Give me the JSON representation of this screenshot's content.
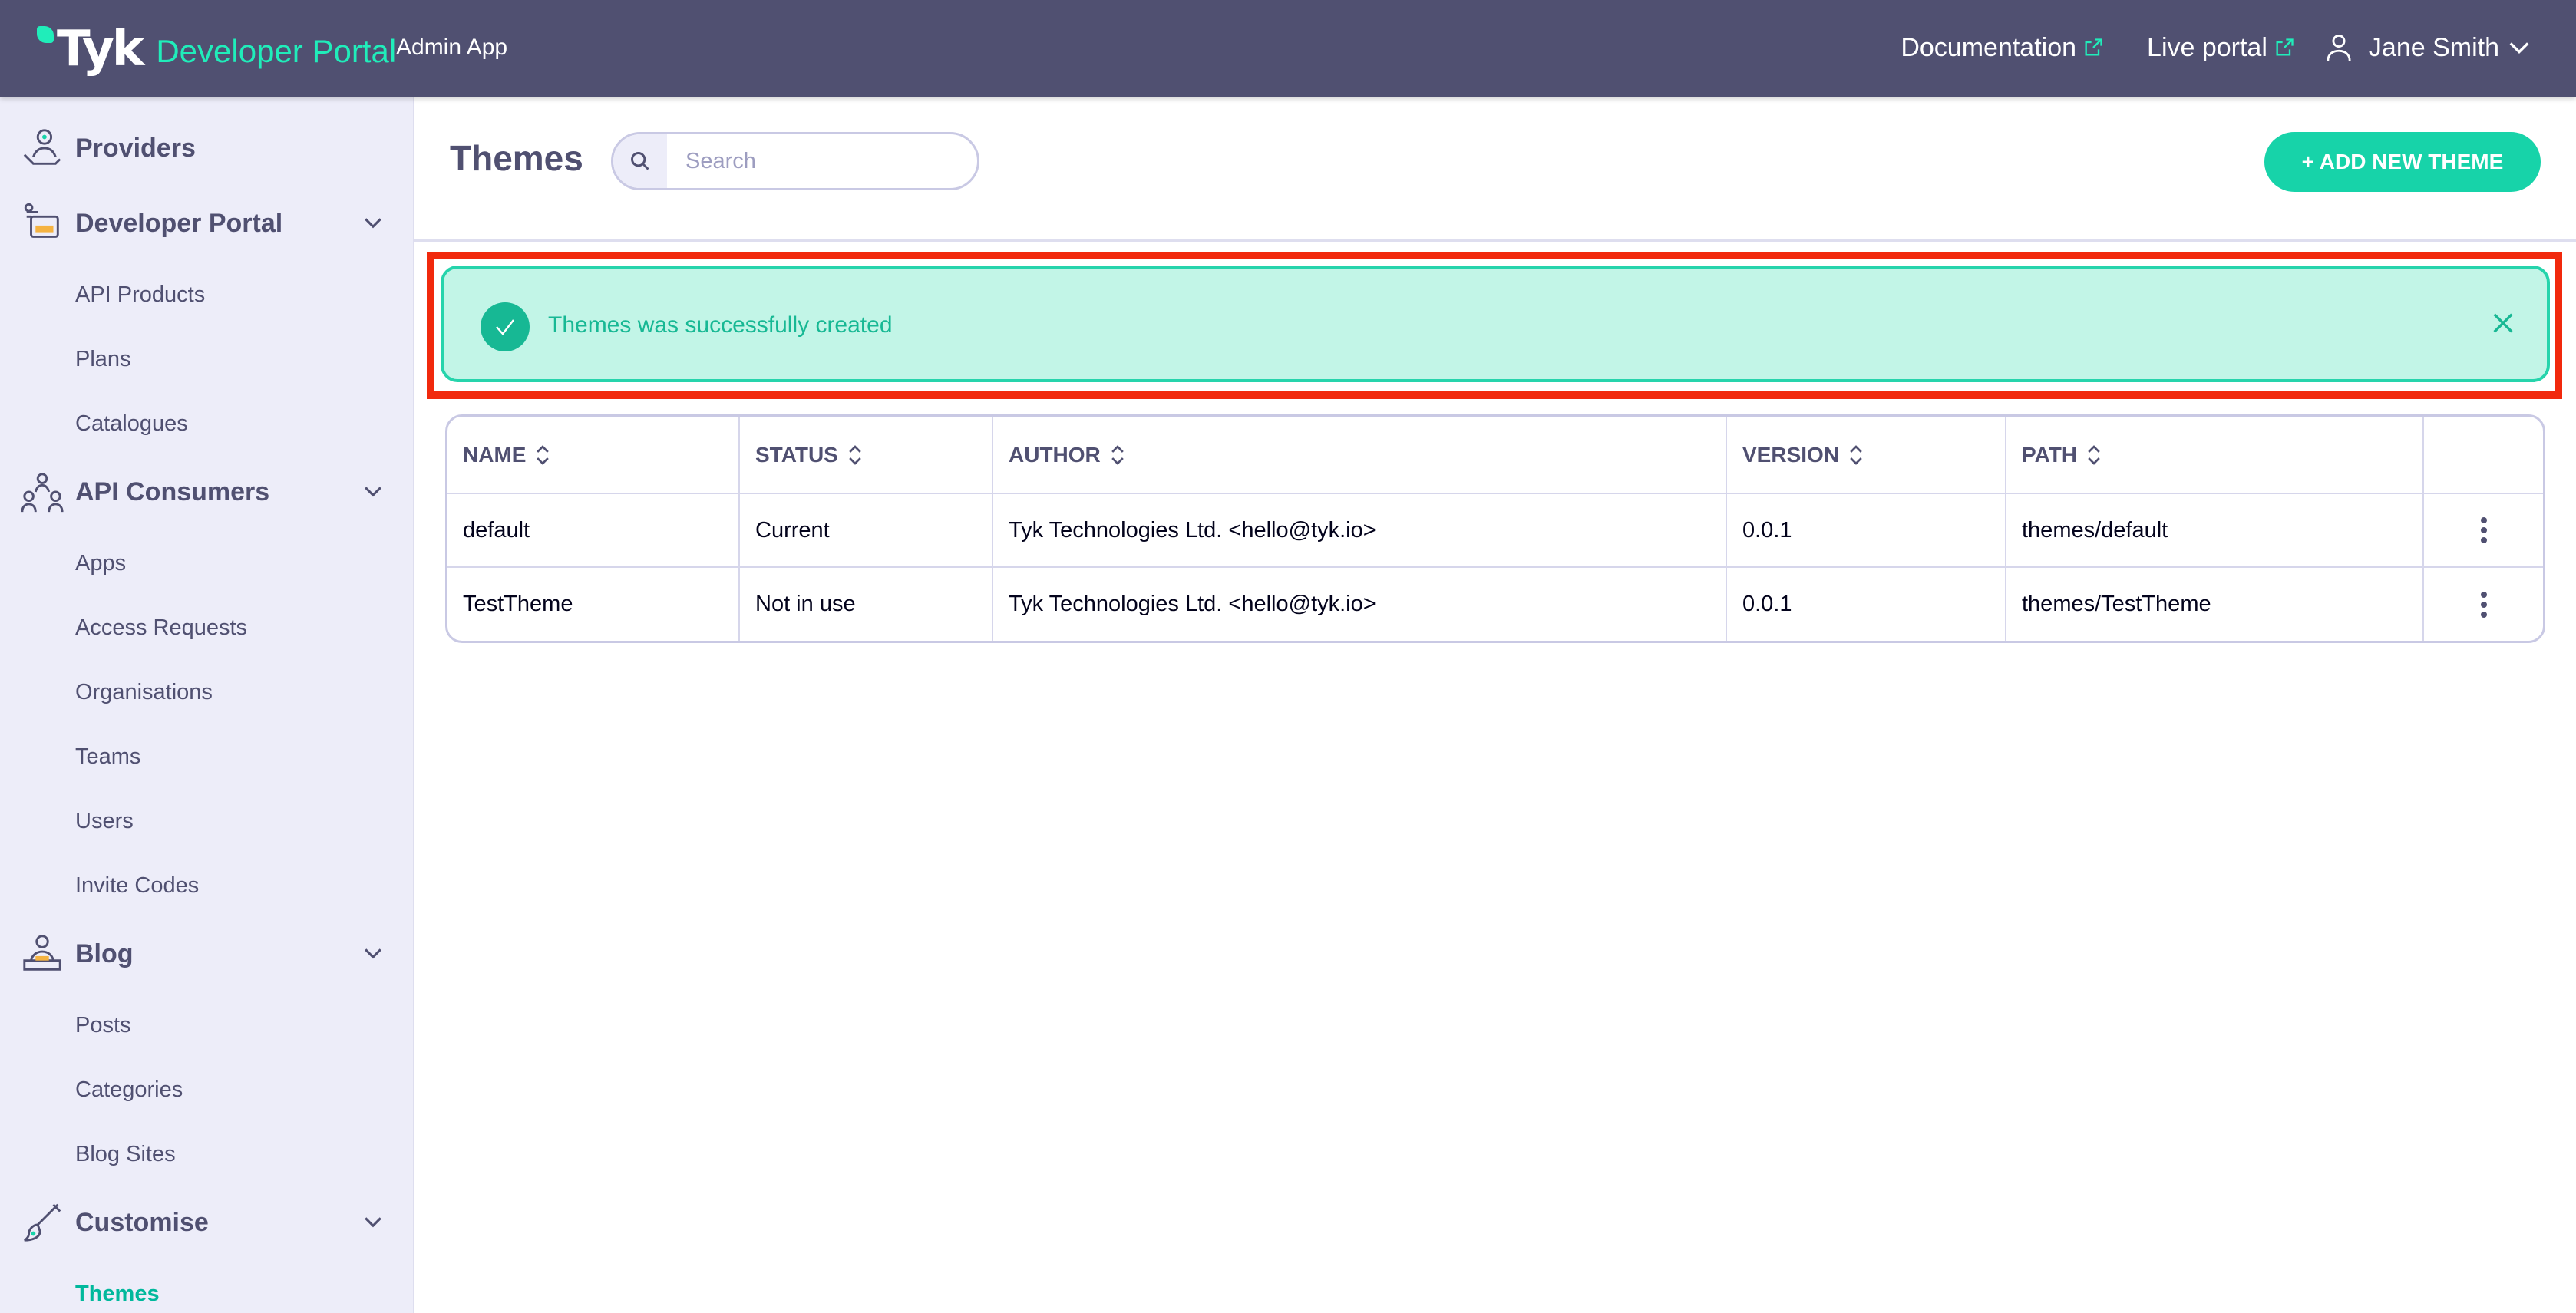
{
  "header": {
    "logo_text": "Tyk",
    "product_name": "Developer Portal",
    "app_name": "Admin App",
    "links": [
      {
        "label": "Documentation",
        "icon": "external-link-icon"
      },
      {
        "label": "Live portal",
        "icon": "external-link-icon"
      }
    ],
    "user_name": "Jane Smith"
  },
  "sidebar": {
    "sections": [
      {
        "label": "Providers",
        "icon": "providers-icon"
      },
      {
        "label": "Developer Portal",
        "icon": "developer-portal-icon",
        "items": [
          "API Products",
          "Plans",
          "Catalogues"
        ]
      },
      {
        "label": "API Consumers",
        "icon": "api-consumers-icon",
        "items": [
          "Apps",
          "Access Requests",
          "Organisations",
          "Teams",
          "Users",
          "Invite Codes"
        ]
      },
      {
        "label": "Blog",
        "icon": "blog-icon",
        "items": [
          "Posts",
          "Categories",
          "Blog Sites"
        ]
      },
      {
        "label": "Customise",
        "icon": "customise-icon",
        "items": [
          "Themes"
        ]
      }
    ],
    "active_item": "Themes"
  },
  "main": {
    "title": "Themes",
    "search_placeholder": "Search",
    "add_button_label": "+ ADD NEW THEME",
    "alert": {
      "message": "Themes was successfully created",
      "status": "success"
    },
    "table": {
      "columns": [
        "NAME",
        "STATUS",
        "AUTHOR",
        "VERSION",
        "PATH"
      ],
      "rows": [
        {
          "name": "default",
          "status": "Current",
          "author": "Tyk Technologies Ltd. <hello@tyk.io>",
          "version": "0.0.1",
          "path": "themes/default"
        },
        {
          "name": "TestTheme",
          "status": "Not in use",
          "author": "Tyk Technologies Ltd. <hello@tyk.io>",
          "version": "0.0.1",
          "path": "themes/TestTheme"
        }
      ]
    }
  },
  "colors": {
    "topbar": "#505071",
    "accent": "#17d3a9",
    "sidebar_bg": "#ededf9",
    "alert_bg": "#c2f5e7",
    "highlight": "#f1290d"
  }
}
